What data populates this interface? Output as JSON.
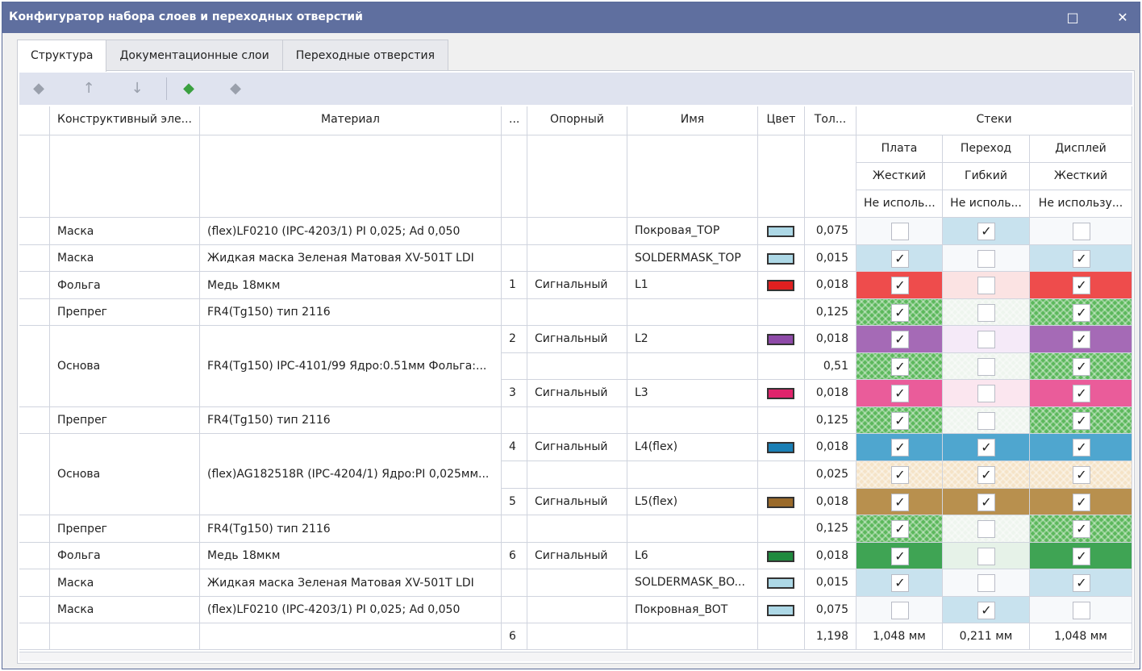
{
  "window": {
    "title": "Конфигуратор набора слоев и переходных отверстий",
    "maximize_icon": "□",
    "close_icon": "✕"
  },
  "tabs": [
    {
      "label": "Структура",
      "active": true
    },
    {
      "label": "Документационные слои",
      "active": false
    },
    {
      "label": "Переходные отверстия",
      "active": false
    }
  ],
  "toolbar": {
    "buttons": [
      {
        "icon": "layer-remove-icon",
        "glyph": "◆",
        "enabled": false
      },
      {
        "icon": "arrow-up-icon",
        "glyph": "↑",
        "enabled": false
      },
      {
        "icon": "arrow-down-icon",
        "glyph": "↓",
        "enabled": false
      },
      {
        "icon": "add-stack-icon",
        "glyph": "◆",
        "enabled": true
      },
      {
        "icon": "stack-settings-icon",
        "glyph": "◆",
        "enabled": false
      }
    ]
  },
  "columns": {
    "element": "Конструктивный эле...",
    "material": "Материал",
    "num": "...",
    "reference": "Опорный",
    "name": "Имя",
    "color": "Цвет",
    "thickness": "Тол...",
    "stacks": "Стеки"
  },
  "stacks": [
    {
      "name": "Плата",
      "type": "Жесткий",
      "usage": "Не исполь..."
    },
    {
      "name": "Переход",
      "type": "Гибкий",
      "usage": "Не исполь..."
    },
    {
      "name": "Дисплей",
      "type": "Жесткий",
      "usage": "Не использу..."
    }
  ],
  "groups": [
    {
      "element": "Маска",
      "material": "(flex)LF0210 (IPC-4203/1) PI 0,025; Ad 0,050",
      "rows": 1
    },
    {
      "element": "Маска",
      "material": "Жидкая маска Зеленая Матовая XV-501T LDI",
      "rows": 1
    },
    {
      "element": "Фольга",
      "material": "Медь 18мкм",
      "rows": 1
    },
    {
      "element": "Препрег",
      "material": "FR4(Tg150) тип 2116",
      "rows": 1
    },
    {
      "element": "Основа",
      "material": "FR4(Tg150) IPC-4101/99 Ядро:0.51мм Фольга:...",
      "rows": 3
    },
    {
      "element": "Препрег",
      "material": "FR4(Tg150) тип 2116",
      "rows": 1
    },
    {
      "element": "Основа",
      "material": "(flex)AG182518R (IPC-4204/1) Ядро:PI 0,025мм...",
      "rows": 3
    },
    {
      "element": "Препрег",
      "material": "FR4(Tg150) тип 2116",
      "rows": 1
    },
    {
      "element": "Фольга",
      "material": "Медь 18мкм",
      "rows": 1
    },
    {
      "element": "Маска",
      "material": "Жидкая маска Зеленая Матовая XV-501T LDI",
      "rows": 1
    },
    {
      "element": "Маска",
      "material": "(flex)LF0210 (IPC-4203/1) PI 0,025; Ad 0,050",
      "rows": 1
    }
  ],
  "rows": [
    {
      "num": "",
      "ref": "",
      "name": "Покровая_TOP",
      "swatch": "#add8e6",
      "thickness": "0,075",
      "checks": [
        false,
        true,
        false
      ],
      "bg": [
        "#f7f9fb",
        "#c8e2ee",
        "#f7f9fb"
      ],
      "pattern": [
        false,
        false,
        false
      ]
    },
    {
      "num": "",
      "ref": "",
      "name": "SOLDERMASK_TOP",
      "swatch": "#add8e6",
      "thickness": "0,015",
      "checks": [
        true,
        false,
        true
      ],
      "bg": [
        "#c8e2ee",
        "#f7f9fb",
        "#c8e2ee"
      ],
      "pattern": [
        false,
        false,
        false
      ]
    },
    {
      "num": "1",
      "ref": "Сигнальный",
      "name": "L1",
      "swatch": "#e02020",
      "thickness": "0,018",
      "checks": [
        true,
        false,
        true
      ],
      "bg": [
        "#ee4c4c",
        "#fbe3e3",
        "#ee4c4c"
      ],
      "pattern": [
        false,
        false,
        false
      ]
    },
    {
      "num": "",
      "ref": "",
      "name": "",
      "swatch": "",
      "thickness": "0,125",
      "checks": [
        true,
        false,
        true
      ],
      "bg": [
        "#5cb85c",
        "#eef5ee",
        "#5cb85c"
      ],
      "pattern": [
        true,
        true,
        true
      ]
    },
    {
      "num": "2",
      "ref": "Сигнальный",
      "name": "L2",
      "swatch": "#8e4aa8",
      "thickness": "0,018",
      "checks": [
        true,
        false,
        true
      ],
      "bg": [
        "#a56ab6",
        "#f5eaf8",
        "#a56ab6"
      ],
      "pattern": [
        false,
        false,
        false
      ]
    },
    {
      "num": "",
      "ref": "",
      "name": "",
      "swatch": "",
      "thickness": "0,51",
      "checks": [
        true,
        false,
        true
      ],
      "bg": [
        "#5cb85c",
        "#eef5ee",
        "#5cb85c"
      ],
      "pattern": [
        true,
        true,
        true
      ]
    },
    {
      "num": "3",
      "ref": "Сигнальный",
      "name": "L3",
      "swatch": "#e0246c",
      "thickness": "0,018",
      "checks": [
        true,
        false,
        true
      ],
      "bg": [
        "#ea5c9a",
        "#fbe6ef",
        "#ea5c9a"
      ],
      "pattern": [
        false,
        false,
        false
      ]
    },
    {
      "num": "",
      "ref": "",
      "name": "",
      "swatch": "",
      "thickness": "0,125",
      "checks": [
        true,
        false,
        true
      ],
      "bg": [
        "#5cb85c",
        "#eef5ee",
        "#5cb85c"
      ],
      "pattern": [
        true,
        true,
        true
      ]
    },
    {
      "num": "4",
      "ref": "Сигнальный",
      "name": "L4(flex)",
      "swatch": "#1a7fb5",
      "thickness": "0,018",
      "checks": [
        true,
        true,
        true
      ],
      "bg": [
        "#4fa6cf",
        "#4fa6cf",
        "#4fa6cf"
      ],
      "pattern": [
        false,
        false,
        false
      ]
    },
    {
      "num": "",
      "ref": "",
      "name": "",
      "swatch": "",
      "thickness": "0,025",
      "checks": [
        true,
        true,
        true
      ],
      "bg": [
        "#f5e3c7",
        "#f5e3c7",
        "#f5e3c7"
      ],
      "pattern": [
        true,
        true,
        true
      ]
    },
    {
      "num": "5",
      "ref": "Сигнальный",
      "name": "L5(flex)",
      "swatch": "#9a6a2a",
      "thickness": "0,018",
      "checks": [
        true,
        true,
        true
      ],
      "bg": [
        "#b8904e",
        "#b8904e",
        "#b8904e"
      ],
      "pattern": [
        false,
        false,
        false
      ]
    },
    {
      "num": "",
      "ref": "",
      "name": "",
      "swatch": "",
      "thickness": "0,125",
      "checks": [
        true,
        false,
        true
      ],
      "bg": [
        "#5cb85c",
        "#eef5ee",
        "#5cb85c"
      ],
      "pattern": [
        true,
        true,
        true
      ]
    },
    {
      "num": "6",
      "ref": "Сигнальный",
      "name": "L6",
      "swatch": "#1f8a3e",
      "thickness": "0,018",
      "checks": [
        true,
        false,
        true
      ],
      "bg": [
        "#3fa454",
        "#e6f2e8",
        "#3fa454"
      ],
      "pattern": [
        false,
        false,
        false
      ]
    },
    {
      "num": "",
      "ref": "",
      "name": "SOLDERMASK_BO...",
      "swatch": "#add8e6",
      "thickness": "0,015",
      "checks": [
        true,
        false,
        true
      ],
      "bg": [
        "#c8e2ee",
        "#f7f9fb",
        "#c8e2ee"
      ],
      "pattern": [
        false,
        false,
        false
      ]
    },
    {
      "num": "",
      "ref": "",
      "name": "Покровная_BOT",
      "swatch": "#add8e6",
      "thickness": "0,075",
      "checks": [
        false,
        true,
        false
      ],
      "bg": [
        "#f7f9fb",
        "#c8e2ee",
        "#f7f9fb"
      ],
      "pattern": [
        false,
        false,
        false
      ]
    }
  ],
  "footer": {
    "num": "6",
    "thickness": "1,198",
    "stack_totals": [
      "1,048 мм",
      "0,211 мм",
      "1,048 мм"
    ]
  },
  "check_glyph": "✓"
}
